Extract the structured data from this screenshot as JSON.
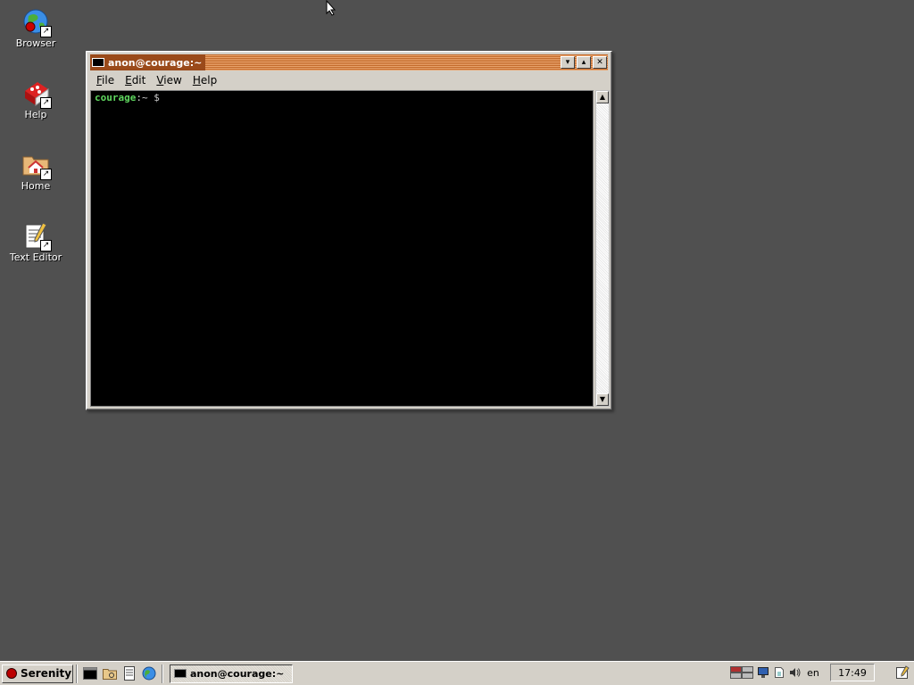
{
  "desktop": {
    "icons": [
      {
        "label": "Browser",
        "icon": "globe-icon"
      },
      {
        "label": "Help",
        "icon": "help-book-icon"
      },
      {
        "label": "Home",
        "icon": "home-folder-icon"
      },
      {
        "label": "Text Editor",
        "icon": "text-editor-icon"
      }
    ]
  },
  "window": {
    "title": "anon@courage:~",
    "controls": [
      "minimize",
      "maximize",
      "close"
    ],
    "menu": [
      {
        "key": "F",
        "rest": "ile"
      },
      {
        "key": "E",
        "rest": "dit"
      },
      {
        "key": "V",
        "rest": "iew"
      },
      {
        "key": "H",
        "rest": "elp"
      }
    ],
    "terminal": {
      "prompt_host": "courage",
      "prompt_rest": ":~ $"
    }
  },
  "taskbar": {
    "start_label": "Serenity",
    "quick_launch": [
      "terminal-icon",
      "file-manager-icon",
      "text-editor-icon",
      "browser-icon"
    ],
    "task": {
      "label": "anon@courage:~"
    },
    "tray": [
      "workspace-icon",
      "network-icon",
      "cpu-icon",
      "audio-icon"
    ],
    "keymap": "en",
    "clock": "17:49"
  },
  "colors": {
    "desktop_bg": "#505050",
    "title_accent": "#c26a2b",
    "prompt_green": "#5fd75f"
  }
}
